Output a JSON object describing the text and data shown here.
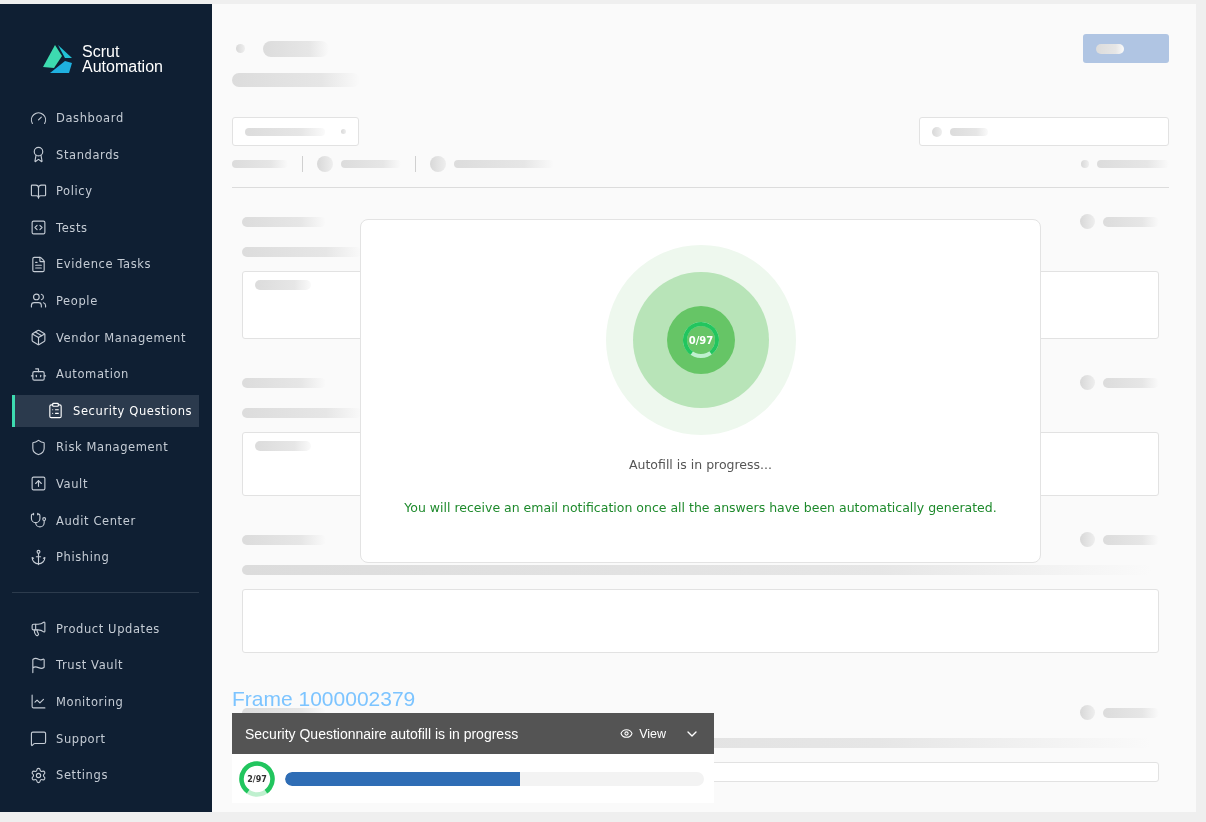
{
  "sidebar": {
    "logo": {
      "line1": "Scrut",
      "line2": "Automation"
    },
    "items": [
      {
        "label": "Dashboard",
        "selected": false
      },
      {
        "label": "Standards",
        "selected": false
      },
      {
        "label": "Policy",
        "selected": false
      },
      {
        "label": "Tests",
        "selected": false
      },
      {
        "label": "Evidence Tasks",
        "selected": false
      },
      {
        "label": "People",
        "selected": false
      },
      {
        "label": "Vendor Management",
        "selected": false
      },
      {
        "label": "Automation",
        "selected": false,
        "children": [
          {
            "label": "Security Questions",
            "selected": true
          }
        ]
      },
      {
        "label": "Risk Management",
        "selected": false
      },
      {
        "label": "Vault",
        "selected": false
      },
      {
        "label": "Audit Center",
        "selected": false
      },
      {
        "label": "Phishing",
        "selected": false
      }
    ],
    "bottom_items": [
      {
        "label": "Product Updates",
        "selected": false
      },
      {
        "label": "Trust Vault",
        "selected": false
      },
      {
        "label": "Monitoring",
        "selected": false
      },
      {
        "label": "Support",
        "selected": false
      },
      {
        "label": "Settings",
        "selected": false
      }
    ]
  },
  "modal": {
    "progress": "0/97",
    "status": "Autofill is in progress...",
    "note": "You will receive an email notification once all the answers have been automatically generated."
  },
  "frame_label": "Frame 1000002379",
  "toast": {
    "title": "Security Questionnaire autofill is in progress",
    "view": "View",
    "progress": "2/97",
    "level": 0.56
  }
}
